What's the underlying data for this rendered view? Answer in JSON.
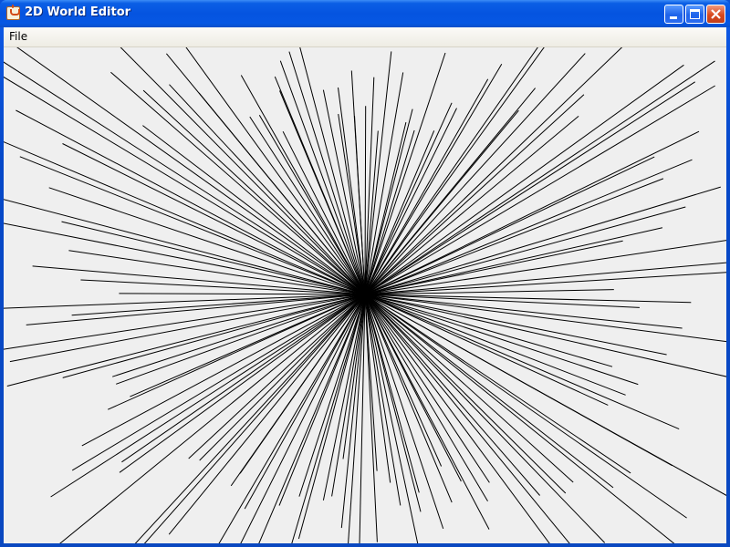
{
  "window": {
    "title": "2D World Editor",
    "icon": "java-cup-icon"
  },
  "titlebar_buttons": {
    "minimize_icon": "minimize-icon",
    "maximize_icon": "maximize-icon",
    "close_icon": "close-icon"
  },
  "menubar": {
    "items": [
      {
        "label": "File"
      }
    ]
  },
  "canvas": {
    "background_color": "#efefef",
    "line_color": "#000000"
  }
}
